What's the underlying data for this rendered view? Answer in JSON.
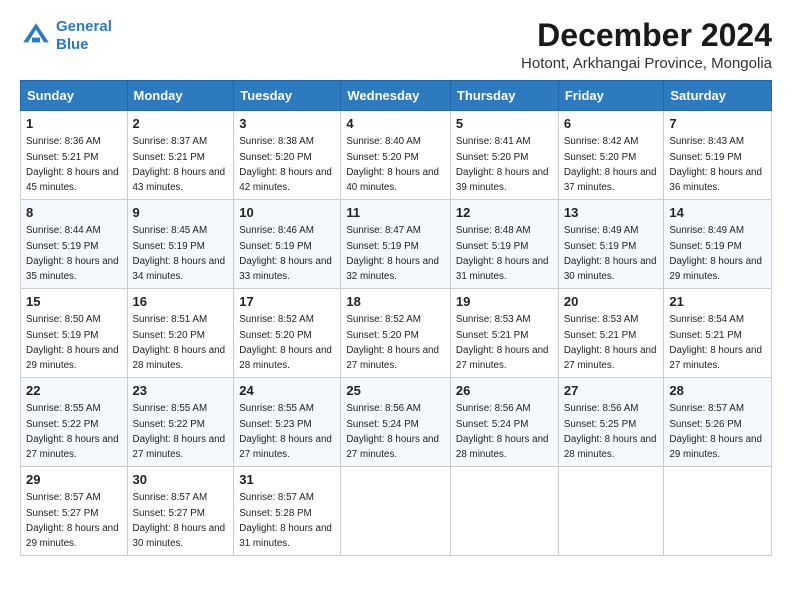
{
  "logo": {
    "line1": "General",
    "line2": "Blue"
  },
  "title": "December 2024",
  "location": "Hotont, Arkhangai Province, Mongolia",
  "days_of_week": [
    "Sunday",
    "Monday",
    "Tuesday",
    "Wednesday",
    "Thursday",
    "Friday",
    "Saturday"
  ],
  "weeks": [
    [
      {
        "day": 1,
        "sunrise": "8:36 AM",
        "sunset": "5:21 PM",
        "daylight": "8 hours and 45 minutes."
      },
      {
        "day": 2,
        "sunrise": "8:37 AM",
        "sunset": "5:21 PM",
        "daylight": "8 hours and 43 minutes."
      },
      {
        "day": 3,
        "sunrise": "8:38 AM",
        "sunset": "5:20 PM",
        "daylight": "8 hours and 42 minutes."
      },
      {
        "day": 4,
        "sunrise": "8:40 AM",
        "sunset": "5:20 PM",
        "daylight": "8 hours and 40 minutes."
      },
      {
        "day": 5,
        "sunrise": "8:41 AM",
        "sunset": "5:20 PM",
        "daylight": "8 hours and 39 minutes."
      },
      {
        "day": 6,
        "sunrise": "8:42 AM",
        "sunset": "5:20 PM",
        "daylight": "8 hours and 37 minutes."
      },
      {
        "day": 7,
        "sunrise": "8:43 AM",
        "sunset": "5:19 PM",
        "daylight": "8 hours and 36 minutes."
      }
    ],
    [
      {
        "day": 8,
        "sunrise": "8:44 AM",
        "sunset": "5:19 PM",
        "daylight": "8 hours and 35 minutes."
      },
      {
        "day": 9,
        "sunrise": "8:45 AM",
        "sunset": "5:19 PM",
        "daylight": "8 hours and 34 minutes."
      },
      {
        "day": 10,
        "sunrise": "8:46 AM",
        "sunset": "5:19 PM",
        "daylight": "8 hours and 33 minutes."
      },
      {
        "day": 11,
        "sunrise": "8:47 AM",
        "sunset": "5:19 PM",
        "daylight": "8 hours and 32 minutes."
      },
      {
        "day": 12,
        "sunrise": "8:48 AM",
        "sunset": "5:19 PM",
        "daylight": "8 hours and 31 minutes."
      },
      {
        "day": 13,
        "sunrise": "8:49 AM",
        "sunset": "5:19 PM",
        "daylight": "8 hours and 30 minutes."
      },
      {
        "day": 14,
        "sunrise": "8:49 AM",
        "sunset": "5:19 PM",
        "daylight": "8 hours and 29 minutes."
      }
    ],
    [
      {
        "day": 15,
        "sunrise": "8:50 AM",
        "sunset": "5:19 PM",
        "daylight": "8 hours and 29 minutes."
      },
      {
        "day": 16,
        "sunrise": "8:51 AM",
        "sunset": "5:20 PM",
        "daylight": "8 hours and 28 minutes."
      },
      {
        "day": 17,
        "sunrise": "8:52 AM",
        "sunset": "5:20 PM",
        "daylight": "8 hours and 28 minutes."
      },
      {
        "day": 18,
        "sunrise": "8:52 AM",
        "sunset": "5:20 PM",
        "daylight": "8 hours and 27 minutes."
      },
      {
        "day": 19,
        "sunrise": "8:53 AM",
        "sunset": "5:21 PM",
        "daylight": "8 hours and 27 minutes."
      },
      {
        "day": 20,
        "sunrise": "8:53 AM",
        "sunset": "5:21 PM",
        "daylight": "8 hours and 27 minutes."
      },
      {
        "day": 21,
        "sunrise": "8:54 AM",
        "sunset": "5:21 PM",
        "daylight": "8 hours and 27 minutes."
      }
    ],
    [
      {
        "day": 22,
        "sunrise": "8:55 AM",
        "sunset": "5:22 PM",
        "daylight": "8 hours and 27 minutes."
      },
      {
        "day": 23,
        "sunrise": "8:55 AM",
        "sunset": "5:22 PM",
        "daylight": "8 hours and 27 minutes."
      },
      {
        "day": 24,
        "sunrise": "8:55 AM",
        "sunset": "5:23 PM",
        "daylight": "8 hours and 27 minutes."
      },
      {
        "day": 25,
        "sunrise": "8:56 AM",
        "sunset": "5:24 PM",
        "daylight": "8 hours and 27 minutes."
      },
      {
        "day": 26,
        "sunrise": "8:56 AM",
        "sunset": "5:24 PM",
        "daylight": "8 hours and 28 minutes."
      },
      {
        "day": 27,
        "sunrise": "8:56 AM",
        "sunset": "5:25 PM",
        "daylight": "8 hours and 28 minutes."
      },
      {
        "day": 28,
        "sunrise": "8:57 AM",
        "sunset": "5:26 PM",
        "daylight": "8 hours and 29 minutes."
      }
    ],
    [
      {
        "day": 29,
        "sunrise": "8:57 AM",
        "sunset": "5:27 PM",
        "daylight": "8 hours and 29 minutes."
      },
      {
        "day": 30,
        "sunrise": "8:57 AM",
        "sunset": "5:27 PM",
        "daylight": "8 hours and 30 minutes."
      },
      {
        "day": 31,
        "sunrise": "8:57 AM",
        "sunset": "5:28 PM",
        "daylight": "8 hours and 31 minutes."
      },
      null,
      null,
      null,
      null
    ]
  ]
}
